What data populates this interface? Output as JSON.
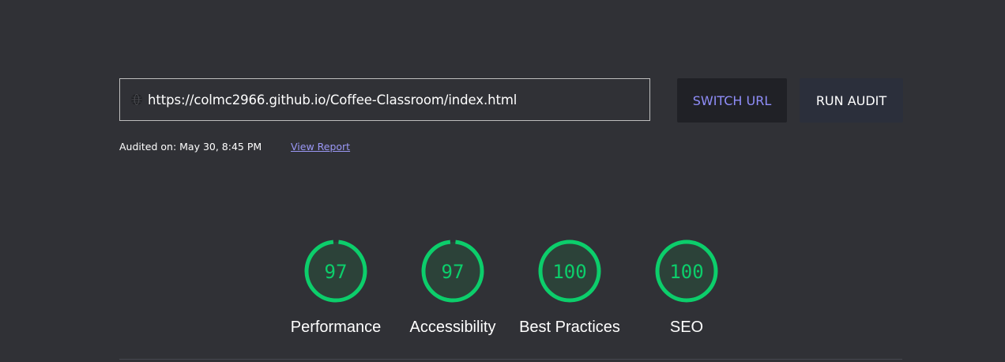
{
  "url_bar": {
    "icon": "globe-icon",
    "value": "https://colmc2966.github.io/Coffee-Classroom/index.html"
  },
  "buttons": {
    "switch_url": "SWITCH URL",
    "run_audit": "RUN AUDIT"
  },
  "audit_info": {
    "audited_on": "Audited on: May 30, 8:45 PM",
    "view_report": "View Report"
  },
  "colors": {
    "background": "#303136",
    "pass_green": "#0cce6b",
    "accent_purple": "#8f8df8"
  },
  "scores": [
    {
      "label": "Performance",
      "score": "97",
      "fraction": 0.97
    },
    {
      "label": "Accessibility",
      "score": "97",
      "fraction": 0.97
    },
    {
      "label": "Best Practices",
      "score": "100",
      "fraction": 1.0
    },
    {
      "label": "SEO",
      "score": "100",
      "fraction": 1.0
    }
  ]
}
